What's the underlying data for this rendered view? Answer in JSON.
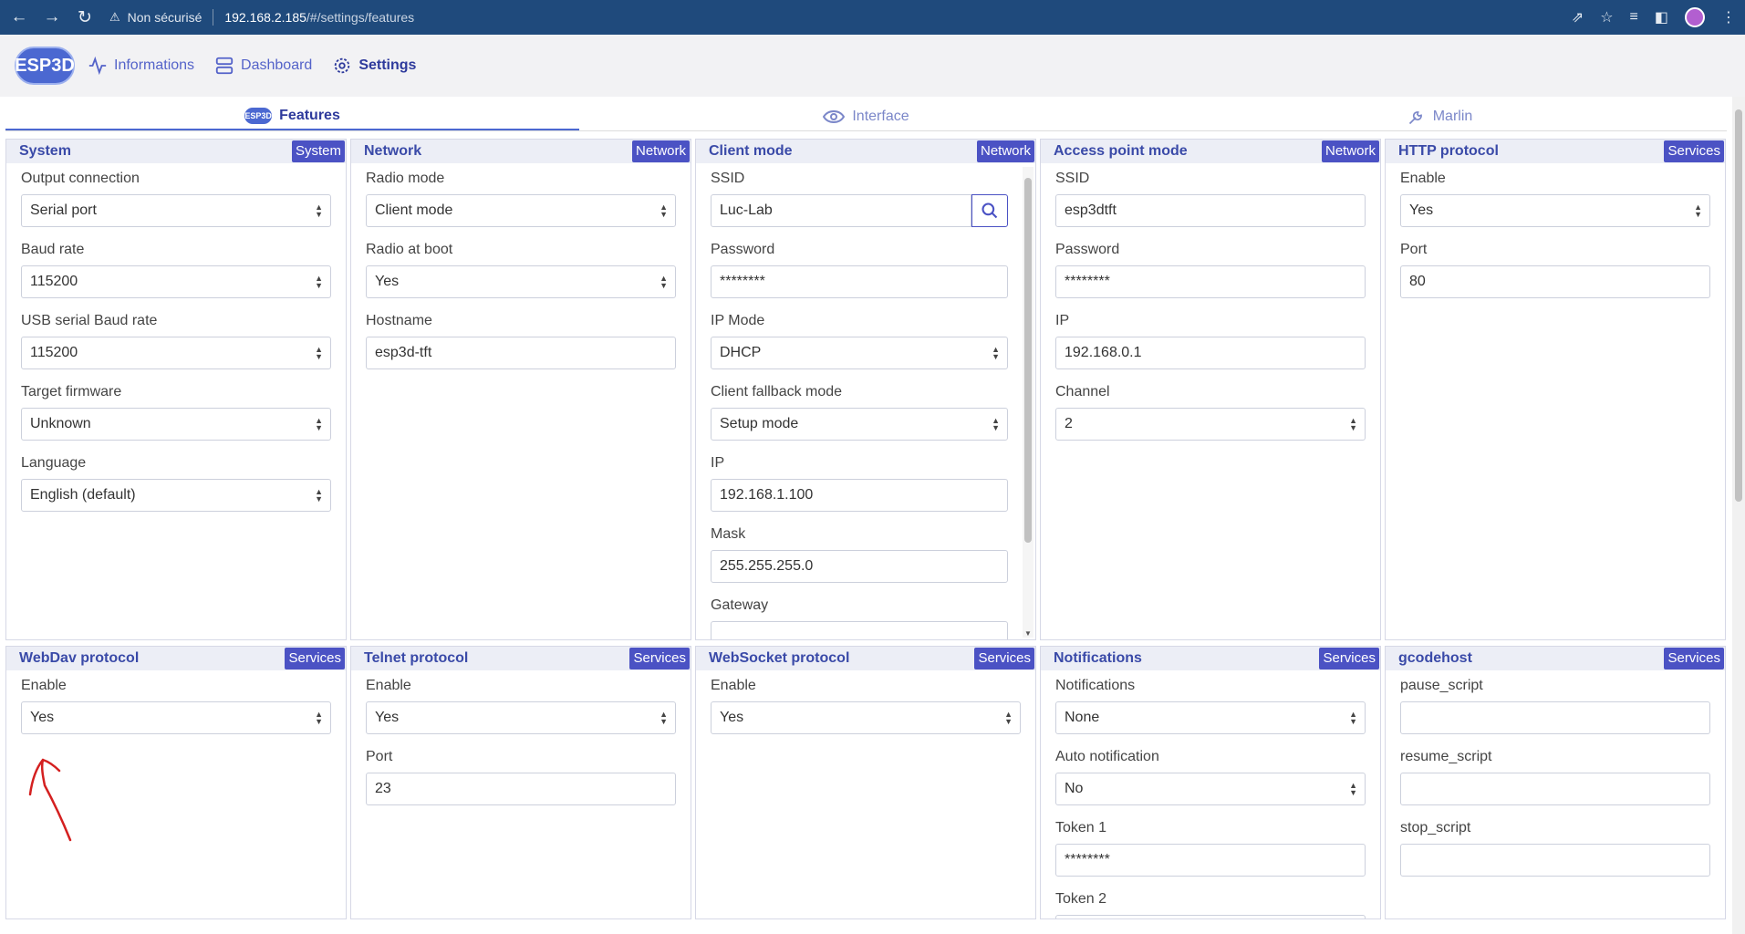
{
  "browser": {
    "security_icon": "warning-icon",
    "security_text": "Non sécurisé",
    "url_host": "192.168.2.185",
    "url_path": "/#/settings/features"
  },
  "appnav": {
    "logo": "ESP3D",
    "items": [
      {
        "label": "Informations",
        "icon": "pulse-icon"
      },
      {
        "label": "Dashboard",
        "icon": "server-icon"
      },
      {
        "label": "Settings",
        "icon": "gear-icon"
      }
    ]
  },
  "tabs": [
    {
      "label": "Features",
      "icon": "esp3d-logo-icon"
    },
    {
      "label": "Interface",
      "icon": "eye-icon"
    },
    {
      "label": "Marlin",
      "icon": "wrench-icon"
    }
  ],
  "panels": {
    "system": {
      "title": "System",
      "badge": "System",
      "fields": [
        {
          "label": "Output connection",
          "value": "Serial port"
        },
        {
          "label": "Baud rate",
          "value": "115200"
        },
        {
          "label": "USB serial Baud rate",
          "value": "115200"
        },
        {
          "label": "Target firmware",
          "value": "Unknown"
        },
        {
          "label": "Language",
          "value": "English (default)"
        }
      ]
    },
    "network": {
      "title": "Network",
      "badge": "Network",
      "fields": [
        {
          "label": "Radio mode",
          "value": "Client mode"
        },
        {
          "label": "Radio at boot",
          "value": "Yes"
        },
        {
          "label": "Hostname",
          "value": "esp3d-tft"
        }
      ]
    },
    "client": {
      "title": "Client mode",
      "badge": "Network",
      "fields": [
        {
          "label": "SSID",
          "value": "Luc-Lab"
        },
        {
          "label": "Password",
          "value": "********"
        },
        {
          "label": "IP Mode",
          "value": "DHCP"
        },
        {
          "label": "Client fallback mode",
          "value": "Setup mode"
        },
        {
          "label": "IP",
          "value": "192.168.1.100"
        },
        {
          "label": "Mask",
          "value": "255.255.255.0"
        },
        {
          "label": "Gateway",
          "value": ""
        }
      ]
    },
    "ap": {
      "title": "Access point mode",
      "badge": "Network",
      "fields": [
        {
          "label": "SSID",
          "value": "esp3dtft"
        },
        {
          "label": "Password",
          "value": "********"
        },
        {
          "label": "IP",
          "value": "192.168.0.1"
        },
        {
          "label": "Channel",
          "value": "2"
        }
      ]
    },
    "http": {
      "title": "HTTP protocol",
      "badge": "Services",
      "fields": [
        {
          "label": "Enable",
          "value": "Yes"
        },
        {
          "label": "Port",
          "value": "80"
        }
      ]
    },
    "webdav": {
      "title": "WebDav protocol",
      "badge": "Services",
      "fields": [
        {
          "label": "Enable",
          "value": "Yes"
        }
      ]
    },
    "telnet": {
      "title": "Telnet protocol",
      "badge": "Services",
      "fields": [
        {
          "label": "Enable",
          "value": "Yes"
        },
        {
          "label": "Port",
          "value": "23"
        }
      ]
    },
    "websocket": {
      "title": "WebSocket protocol",
      "badge": "Services",
      "fields": [
        {
          "label": "Enable",
          "value": "Yes"
        }
      ]
    },
    "notifications": {
      "title": "Notifications",
      "badge": "Services",
      "fields": [
        {
          "label": "Notifications",
          "value": "None"
        },
        {
          "label": "Auto notification",
          "value": "No"
        },
        {
          "label": "Token 1",
          "value": "********"
        },
        {
          "label": "Token 2",
          "value": ""
        }
      ]
    },
    "gcodehost": {
      "title": "gcodehost",
      "badge": "Services",
      "fields": [
        {
          "label": "pause_script",
          "value": ""
        },
        {
          "label": "resume_script",
          "value": ""
        },
        {
          "label": "stop_script",
          "value": ""
        }
      ]
    }
  },
  "colors": {
    "accent": "#4b52c4",
    "annotation": "#d42020"
  }
}
